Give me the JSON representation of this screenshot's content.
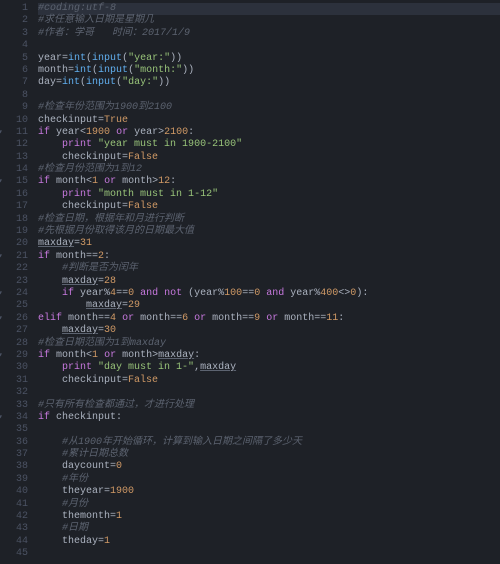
{
  "lines": [
    {
      "n": 1,
      "cls": "hl",
      "html": "<span class='c'>#coding:utf-8</span>"
    },
    {
      "n": 2,
      "html": "<span class='c'>#求任意输入日期是星期几</span>"
    },
    {
      "n": 3,
      "html": "<span class='c'>#作者：学哥   时间：2017/1/9</span>"
    },
    {
      "n": 4,
      "html": ""
    },
    {
      "n": 5,
      "html": "year=<span class='f'>int</span>(<span class='f'>input</span>(<span class='s'>\"year:\"</span>))"
    },
    {
      "n": 6,
      "html": "month=<span class='f'>int</span>(<span class='f'>input</span>(<span class='s'>\"month:\"</span>))"
    },
    {
      "n": 7,
      "html": "day=<span class='f'>int</span>(<span class='f'>input</span>(<span class='s'>\"day:\"</span>))"
    },
    {
      "n": 8,
      "html": ""
    },
    {
      "n": 9,
      "html": "<span class='c'>#检查年份范围为1900到2100</span>"
    },
    {
      "n": 10,
      "html": "checkinput=<span class='n'>True</span>"
    },
    {
      "n": 11,
      "fold": true,
      "html": "<span class='k'>if</span> year&lt;<span class='n'>1900</span> <span class='k'>or</span> year&gt;<span class='n'>2100</span>:"
    },
    {
      "n": 12,
      "html": "    <span class='k'>print</span> <span class='s'>\"year must in 1900-2100\"</span>"
    },
    {
      "n": 13,
      "html": "    checkinput=<span class='n'>False</span>"
    },
    {
      "n": 14,
      "html": "<span class='c'>#检查月份范围为1到12</span>"
    },
    {
      "n": 15,
      "fold": true,
      "html": "<span class='k'>if</span> month&lt;<span class='n'>1</span> <span class='k'>or</span> month&gt;<span class='n'>12</span>:"
    },
    {
      "n": 16,
      "html": "    <span class='k'>print</span> <span class='s'>\"month must in 1-12\"</span>"
    },
    {
      "n": 17,
      "html": "    checkinput=<span class='n'>False</span>"
    },
    {
      "n": 18,
      "html": "<span class='c'>#检查日期，根据年和月进行判断</span>"
    },
    {
      "n": 19,
      "html": "<span class='c'>#先根据月份取得该月的日期最大值</span>"
    },
    {
      "n": 20,
      "html": "<span class='u'>maxday</span>=<span class='n'>31</span>"
    },
    {
      "n": 21,
      "fold": true,
      "html": "<span class='k'>if</span> month==<span class='n'>2</span>:"
    },
    {
      "n": 22,
      "html": "    <span class='c'>#判断是否为闰年</span>"
    },
    {
      "n": 23,
      "html": "    <span class='u'>maxday</span>=<span class='n'>28</span>"
    },
    {
      "n": 24,
      "fold": true,
      "html": "    <span class='k'>if</span> year%<span class='n'>4</span>==<span class='n'>0</span> <span class='k'>and</span> <span class='k'>not</span> (year%<span class='n'>100</span>==<span class='n'>0</span> <span class='k'>and</span> year%<span class='n'>400</span>&lt;&gt;<span class='n'>0</span>):"
    },
    {
      "n": 25,
      "html": "        <span class='u'>maxday</span>=<span class='n'>29</span>"
    },
    {
      "n": 26,
      "fold": true,
      "html": "<span class='k'>elif</span> month==<span class='n'>4</span> <span class='k'>or</span> month==<span class='n'>6</span> <span class='k'>or</span> month==<span class='n'>9</span> <span class='k'>or</span> month==<span class='n'>11</span>:"
    },
    {
      "n": 27,
      "html": "    <span class='u'>maxday</span>=<span class='n'>30</span>"
    },
    {
      "n": 28,
      "html": "<span class='c'>#检查日期范围为1到maxday</span>"
    },
    {
      "n": 29,
      "fold": true,
      "html": "<span class='k'>if</span> month&lt;<span class='n'>1</span> <span class='k'>or</span> month&gt;<span class='u'>maxday</span>:"
    },
    {
      "n": 30,
      "html": "    <span class='k'>print</span> <span class='s'>\"day must in 1-\"</span>,<span class='u'>maxday</span>"
    },
    {
      "n": 31,
      "html": "    checkinput=<span class='n'>False</span>"
    },
    {
      "n": 32,
      "html": ""
    },
    {
      "n": 33,
      "html": "<span class='c'>#只有所有检查都通过，才进行处理</span>"
    },
    {
      "n": 34,
      "fold": true,
      "html": "<span class='k'>if</span> checkinput:"
    },
    {
      "n": 35,
      "html": ""
    },
    {
      "n": 36,
      "html": "    <span class='c'>#从1900年开始循环，计算到输入日期之间隔了多少天</span>"
    },
    {
      "n": 37,
      "html": "    <span class='c'>#累计日期总数</span>"
    },
    {
      "n": 38,
      "html": "    daycount=<span class='n'>0</span>"
    },
    {
      "n": 39,
      "html": "    <span class='c'>#年份</span>"
    },
    {
      "n": 40,
      "html": "    theyear=<span class='n'>1900</span>"
    },
    {
      "n": 41,
      "html": "    <span class='c'>#月份</span>"
    },
    {
      "n": 42,
      "html": "    themonth=<span class='n'>1</span>"
    },
    {
      "n": 43,
      "html": "    <span class='c'>#日期</span>"
    },
    {
      "n": 44,
      "html": "    theday=<span class='n'>1</span>"
    },
    {
      "n": 45,
      "html": ""
    }
  ]
}
